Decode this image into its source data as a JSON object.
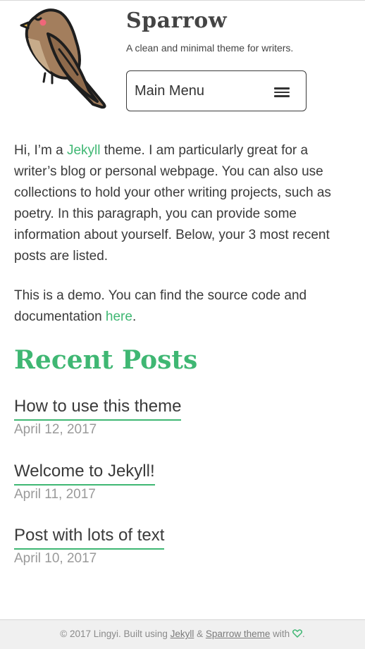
{
  "header": {
    "site_title": "Sparrow",
    "tagline": "A clean and minimal theme for writers.",
    "menu_label": "Main Menu"
  },
  "intro": {
    "p1_before": "Hi, I’m a ",
    "p1_link": "Jekyll",
    "p1_after": " theme. I am particularly great for a writer’s blog or personal webpage. You can also use collections to hold your other writing projects, such as poetry. In this paragraph, you can provide some information about yourself. Below, your 3 most recent posts are listed.",
    "p2_before": "This is a demo. You can find the source code and documentation ",
    "p2_link": "here",
    "p2_after": "."
  },
  "recent": {
    "title": "Recent Posts",
    "posts": [
      {
        "title": "How to use this theme",
        "date": "April 12, 2017"
      },
      {
        "title": "Welcome to Jekyll!",
        "date": "April 11, 2017"
      },
      {
        "title": "Post with lots of text",
        "date": "April 10, 2017"
      }
    ]
  },
  "footer": {
    "prefix": "© 2017 Lingyi. Built using ",
    "link1": "Jekyll",
    "amp": " & ",
    "link2": "Sparrow theme",
    "with": " with ",
    "suffix": "."
  },
  "colors": {
    "accent": "#3fb773",
    "text": "#3a3a3a",
    "muted": "#9a9a9a"
  },
  "icons": {
    "logo": "sparrow-bird-icon",
    "menu": "hamburger-icon",
    "footer": "heart-icon"
  }
}
